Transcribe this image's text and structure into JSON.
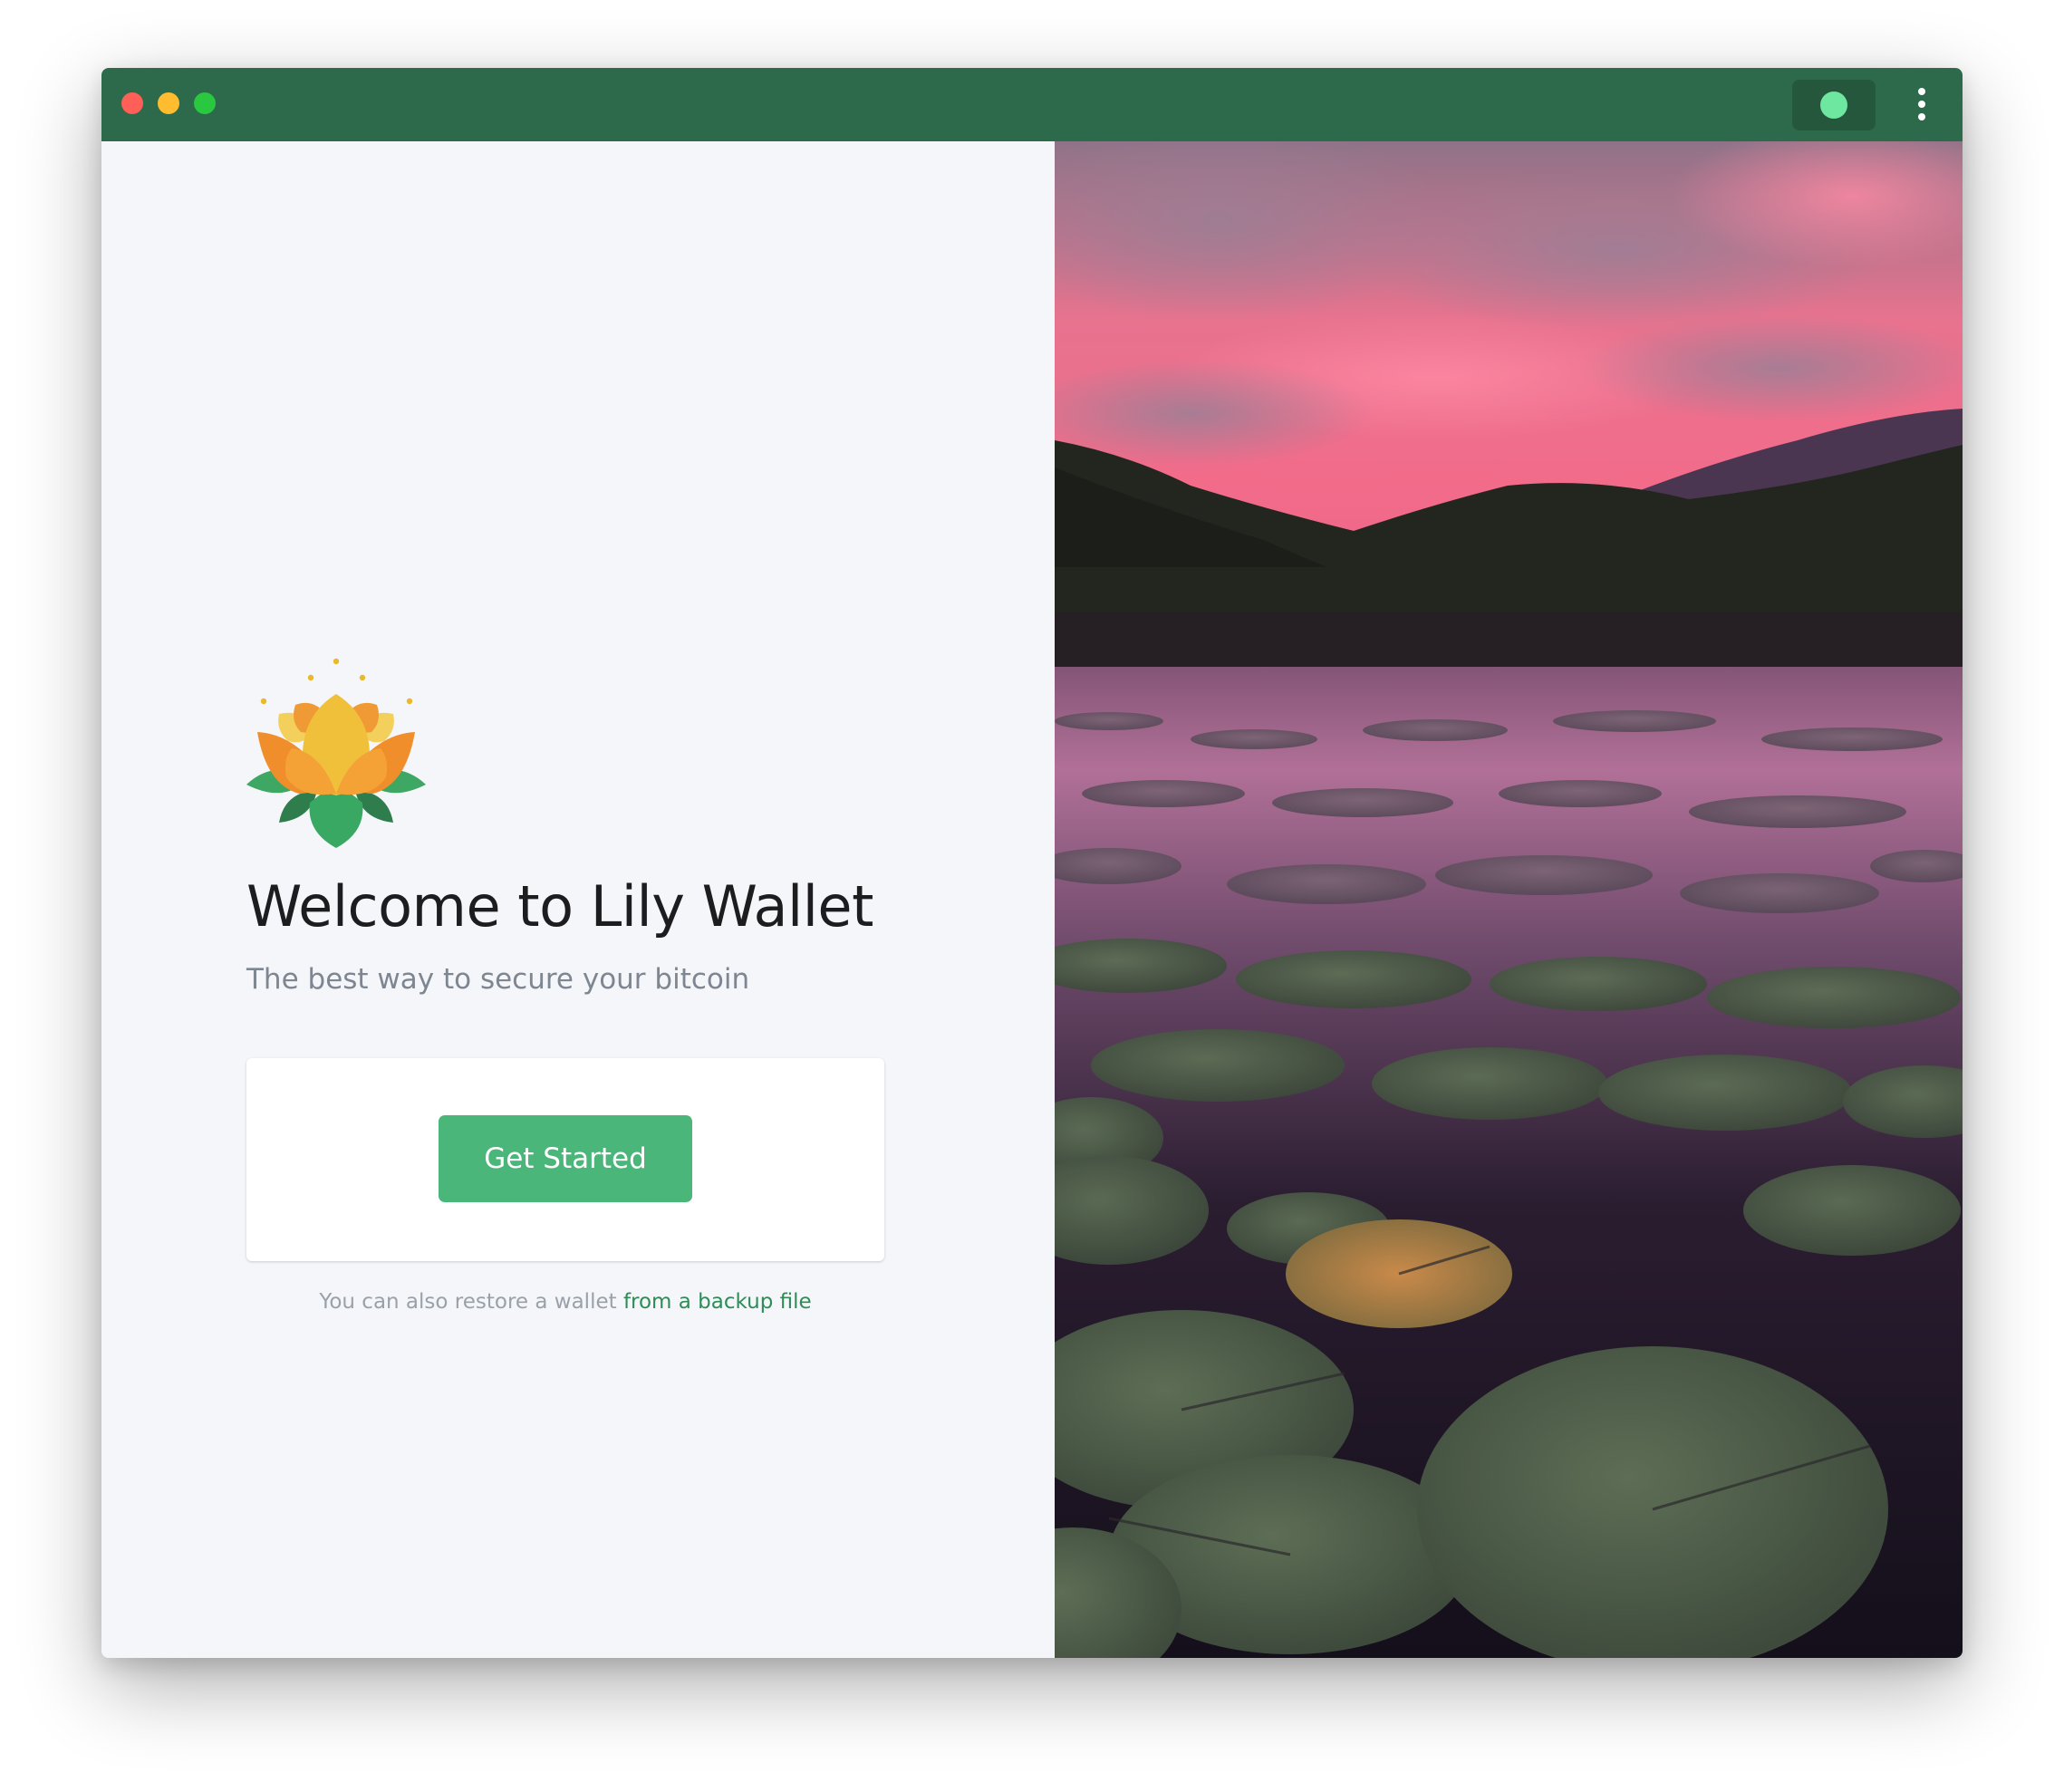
{
  "window": {
    "controls": [
      "close",
      "minimize",
      "maximize"
    ],
    "titlebar_color": "#2c6a4b",
    "status_color": "#6ee7a0",
    "menu_icon": "more-vertical-icon"
  },
  "welcome": {
    "logo": "lotus-logo",
    "title": "Welcome to Lily Wallet",
    "subtitle": "The best way to secure your bitcoin",
    "get_started_label": "Get Started",
    "restore_prefix": "You can also restore a wallet",
    "restore_link": "from a backup file",
    "accent_color": "#4bb67a"
  },
  "hero": {
    "image": "sunset-lily-pad-lake-photo"
  }
}
